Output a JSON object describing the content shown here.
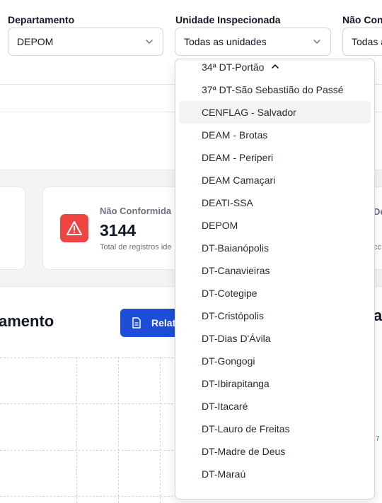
{
  "filters": {
    "departamento": {
      "label": "Departamento",
      "value": "DEPOM"
    },
    "unidade": {
      "label": "Unidade Inspecionada",
      "value": "Todas as unidades"
    },
    "nao_conformidade": {
      "label": "Não Con",
      "value": "Todas a"
    }
  },
  "card": {
    "title": "Não Conformida",
    "value": "3144",
    "subtitle": "Total de registros ide",
    "right_title_fragment": "De",
    "right_sub_fragment": "cc"
  },
  "section": {
    "title": "amento",
    "report_button": "Relat",
    "right_title_fragment": "a",
    "right_link_fragment": "7"
  },
  "dropdown": {
    "items": [
      "34ª DT-Portão",
      "37ª DT-São Sebastião do Passé",
      "CENFLAG - Salvador",
      "DEAM - Brotas",
      "DEAM - Periperi",
      "DEAM Camaçari",
      "DEATI-SSA",
      "DEPOM",
      "DT-Baianópolis",
      "DT-Canavieiras",
      "DT-Cotegipe",
      "DT-Cristópolis",
      "DT-Dias D'Ávila",
      "DT-Gongogi",
      "DT-Ibirapitanga",
      "DT-Itacaré",
      "DT-Lauro de Freitas",
      "DT-Madre de Deus",
      "DT-Maraú"
    ],
    "highlighted": "CENFLAG - Salvador"
  },
  "colors": {
    "accent": "#1d4ed8",
    "danger": "#ef4444",
    "highlight": "#f3f3f3"
  }
}
